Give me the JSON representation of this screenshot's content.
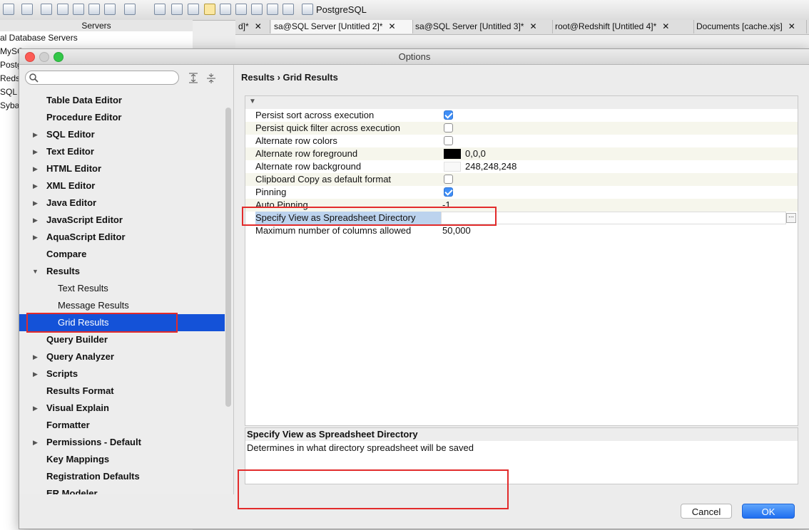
{
  "app": {
    "postgres_label": "PostgreSQL",
    "servers_header": "Servers",
    "servers": [
      "al Database Servers",
      "MySQ",
      "Postg",
      "Reds",
      "SQL S",
      "Syba"
    ],
    "tabs": [
      {
        "label": "d]*",
        "close": "✕"
      },
      {
        "label": "sa@SQL Server [Untitled 2]*",
        "close": "✕"
      },
      {
        "label": "sa@SQL Server [Untitled 3]*",
        "close": "✕"
      },
      {
        "label": "root@Redshift [Untitled 4]*",
        "close": "✕"
      },
      {
        "label": "Documents [cache.xjs]",
        "close": "✕"
      }
    ]
  },
  "dialog": {
    "title": "Options",
    "search_placeholder": "",
    "tree": [
      {
        "label": "Table Data Editor",
        "expandable": false
      },
      {
        "label": "Procedure Editor",
        "expandable": false
      },
      {
        "label": "SQL Editor",
        "expandable": true
      },
      {
        "label": "Text Editor",
        "expandable": true
      },
      {
        "label": "HTML Editor",
        "expandable": true
      },
      {
        "label": "XML Editor",
        "expandable": true
      },
      {
        "label": "Java Editor",
        "expandable": true
      },
      {
        "label": "JavaScript Editor",
        "expandable": true
      },
      {
        "label": "AquaScript Editor",
        "expandable": true
      },
      {
        "label": "Compare",
        "expandable": false
      },
      {
        "label": "Results",
        "expanded": true
      },
      {
        "label": "Text Results",
        "child": true
      },
      {
        "label": "Message Results",
        "child": true
      },
      {
        "label": "Grid Results",
        "child": true,
        "selected": true
      },
      {
        "label": "Query Builder",
        "expandable": false
      },
      {
        "label": "Query Analyzer",
        "expandable": true
      },
      {
        "label": "Scripts",
        "expandable": true
      },
      {
        "label": "Results Format",
        "expandable": false
      },
      {
        "label": "Visual Explain",
        "expandable": true
      },
      {
        "label": "Formatter",
        "expandable": false
      },
      {
        "label": "Permissions - Default",
        "expandable": true
      },
      {
        "label": "Key Mappings",
        "expandable": false
      },
      {
        "label": "Registration Defaults",
        "expandable": false
      },
      {
        "label": "ER Modeler",
        "expandable": false
      }
    ],
    "breadcrumb": "Results › Grid Results",
    "properties": [
      {
        "name": "Persist sort across execution",
        "type": "checkbox",
        "checked": true
      },
      {
        "name": "Persist quick filter across execution",
        "type": "checkbox",
        "checked": false
      },
      {
        "name": "Alternate row colors",
        "type": "checkbox",
        "checked": false
      },
      {
        "name": "Alternate row foreground",
        "type": "color",
        "color": "#000000",
        "value": "0,0,0"
      },
      {
        "name": "Alternate row background",
        "type": "color",
        "color": "#f8f8f8",
        "value": "248,248,248"
      },
      {
        "name": "Clipboard Copy as default format",
        "type": "checkbox",
        "checked": false
      },
      {
        "name": "Pinning",
        "type": "checkbox",
        "checked": true
      },
      {
        "name": "Auto Pinning",
        "type": "text",
        "value": "-1"
      },
      {
        "name": "Specify View as Spreadsheet Directory",
        "type": "edit",
        "value": "",
        "highlighted": true
      },
      {
        "name": "Maximum number of columns allowed",
        "type": "text",
        "value": "50,000"
      }
    ],
    "description": {
      "title": "Specify View as Spreadsheet Directory",
      "text": "Determines in what directory spreadsheet will be saved"
    },
    "buttons": {
      "cancel": "Cancel",
      "ok": "OK"
    }
  },
  "colors": {
    "selection": "#1452d8",
    "annotation": "#e22b2b",
    "checkbox_on": "#3f8ef7"
  }
}
